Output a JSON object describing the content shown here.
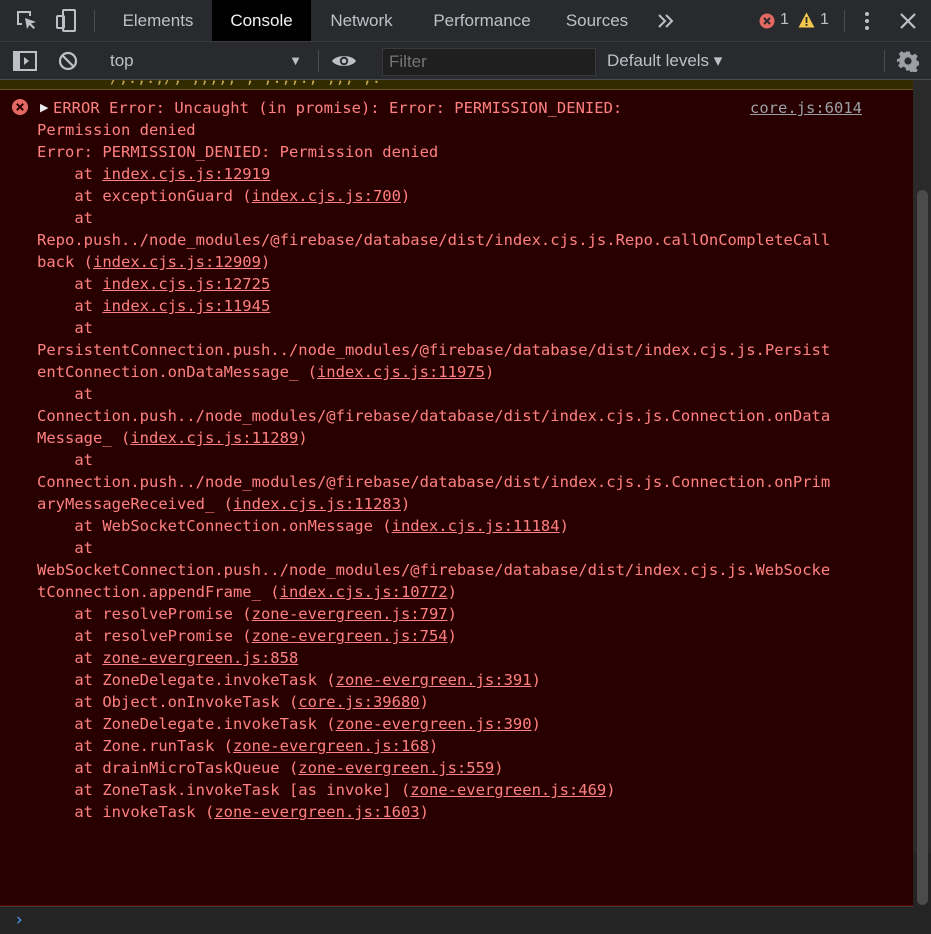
{
  "tabs": [
    {
      "label": "Elements",
      "active": false
    },
    {
      "label": "Console",
      "active": true
    },
    {
      "label": "Network",
      "active": false
    },
    {
      "label": "Performance",
      "active": false
    },
    {
      "label": "Sources",
      "active": false
    }
  ],
  "more_tabs_icon": "double-chevron-right-icon",
  "counts": {
    "errors": "1",
    "warnings": "1"
  },
  "toolbar": {
    "context": "top",
    "filter_placeholder": "Filter",
    "levels": "Default levels ▾"
  },
  "colors": {
    "error_text": "#ff8080",
    "error_bg": "#290000",
    "prompt": "#4d9cff"
  },
  "message": {
    "source": "core.js:6014",
    "lines": [
      [
        {
          "t": "ERROR Error: Uncaught (in promise): Error: PERMISSION_DENIED:"
        }
      ],
      [
        {
          "t": "Permission denied"
        }
      ],
      [
        {
          "t": "Error: PERMISSION_DENIED: Permission denied"
        }
      ],
      [
        {
          "t": "    at "
        },
        {
          "t": "index.cjs.js:12919",
          "link": true
        }
      ],
      [
        {
          "t": "    at exceptionGuard ("
        },
        {
          "t": "index.cjs.js:700",
          "link": true
        },
        {
          "t": ")"
        }
      ],
      [
        {
          "t": "    at"
        }
      ],
      [
        {
          "t": "Repo.push../node_modules/@firebase/database/dist/index.cjs.js.Repo.callOnCompleteCall"
        }
      ],
      [
        {
          "t": "back ("
        },
        {
          "t": "index.cjs.js:12909",
          "link": true
        },
        {
          "t": ")"
        }
      ],
      [
        {
          "t": "    at "
        },
        {
          "t": "index.cjs.js:12725",
          "link": true
        }
      ],
      [
        {
          "t": "    at "
        },
        {
          "t": "index.cjs.js:11945",
          "link": true
        }
      ],
      [
        {
          "t": "    at"
        }
      ],
      [
        {
          "t": "PersistentConnection.push../node_modules/@firebase/database/dist/index.cjs.js.Persist"
        }
      ],
      [
        {
          "t": "entConnection.onDataMessage_ ("
        },
        {
          "t": "index.cjs.js:11975",
          "link": true
        },
        {
          "t": ")"
        }
      ],
      [
        {
          "t": "    at"
        }
      ],
      [
        {
          "t": "Connection.push../node_modules/@firebase/database/dist/index.cjs.js.Connection.onData"
        }
      ],
      [
        {
          "t": "Message_ ("
        },
        {
          "t": "index.cjs.js:11289",
          "link": true
        },
        {
          "t": ")"
        }
      ],
      [
        {
          "t": "    at"
        }
      ],
      [
        {
          "t": "Connection.push../node_modules/@firebase/database/dist/index.cjs.js.Connection.onPrim"
        }
      ],
      [
        {
          "t": "aryMessageReceived_ ("
        },
        {
          "t": "index.cjs.js:11283",
          "link": true
        },
        {
          "t": ")"
        }
      ],
      [
        {
          "t": "    at WebSocketConnection.onMessage ("
        },
        {
          "t": "index.cjs.js:11184",
          "link": true
        },
        {
          "t": ")"
        }
      ],
      [
        {
          "t": "    at"
        }
      ],
      [
        {
          "t": "WebSocketConnection.push../node_modules/@firebase/database/dist/index.cjs.js.WebSocke"
        }
      ],
      [
        {
          "t": "tConnection.appendFrame_ ("
        },
        {
          "t": "index.cjs.js:10772",
          "link": true
        },
        {
          "t": ")"
        }
      ],
      [
        {
          "t": "    at resolvePromise ("
        },
        {
          "t": "zone-evergreen.js:797",
          "link": true
        },
        {
          "t": ")"
        }
      ],
      [
        {
          "t": "    at resolvePromise ("
        },
        {
          "t": "zone-evergreen.js:754",
          "link": true
        },
        {
          "t": ")"
        }
      ],
      [
        {
          "t": "    at "
        },
        {
          "t": "zone-evergreen.js:858",
          "link": true
        }
      ],
      [
        {
          "t": "    at ZoneDelegate.invokeTask ("
        },
        {
          "t": "zone-evergreen.js:391",
          "link": true
        },
        {
          "t": ")"
        }
      ],
      [
        {
          "t": "    at Object.onInvokeTask ("
        },
        {
          "t": "core.js:39680",
          "link": true
        },
        {
          "t": ")"
        }
      ],
      [
        {
          "t": "    at ZoneDelegate.invokeTask ("
        },
        {
          "t": "zone-evergreen.js:390",
          "link": true
        },
        {
          "t": ")"
        }
      ],
      [
        {
          "t": "    at Zone.runTask ("
        },
        {
          "t": "zone-evergreen.js:168",
          "link": true
        },
        {
          "t": ")"
        }
      ],
      [
        {
          "t": "    at drainMicroTaskQueue ("
        },
        {
          "t": "zone-evergreen.js:559",
          "link": true
        },
        {
          "t": ")"
        }
      ],
      [
        {
          "t": "    at ZoneTask.invokeTask [as invoke] ("
        },
        {
          "t": "zone-evergreen.js:469",
          "link": true
        },
        {
          "t": ")"
        }
      ],
      [
        {
          "t": "    at invokeTask ("
        },
        {
          "t": "zone-evergreen.js:1603",
          "link": true
        },
        {
          "t": ")"
        }
      ]
    ]
  },
  "prompt_symbol": "›"
}
